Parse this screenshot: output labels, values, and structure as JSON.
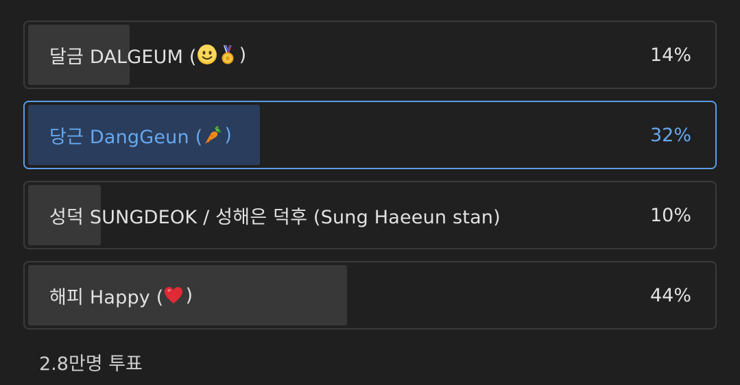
{
  "poll": {
    "options": [
      {
        "label_prefix": "달금 DALGEUM (",
        "label_suffix": ")",
        "emojis": [
          "smiley-face-icon",
          "medal-icon"
        ],
        "percent_text": "14%",
        "percent": 14,
        "selected": false
      },
      {
        "label_prefix": "당근 DangGeun (",
        "label_suffix": ")",
        "emojis": [
          "carrot-icon"
        ],
        "percent_text": "32%",
        "percent": 32,
        "selected": true
      },
      {
        "label_prefix": "성덕 SUNGDEOK / 성해은 덕후 (Sung Haeeun stan)",
        "label_suffix": "",
        "emojis": [],
        "percent_text": "10%",
        "percent": 10,
        "selected": false
      },
      {
        "label_prefix": "해피 Happy (",
        "label_suffix": ")",
        "emojis": [
          "heart-icon"
        ],
        "percent_text": "44%",
        "percent": 44,
        "selected": false
      }
    ],
    "vote_count": "2.8만명 투표"
  },
  "colors": {
    "background": "#1f1f1f",
    "border": "#3b3b3b",
    "fill": "#383838",
    "selected_accent": "#5a9de8",
    "selected_fill": "#2a3d5c",
    "selected_text": "#66a8f0"
  }
}
